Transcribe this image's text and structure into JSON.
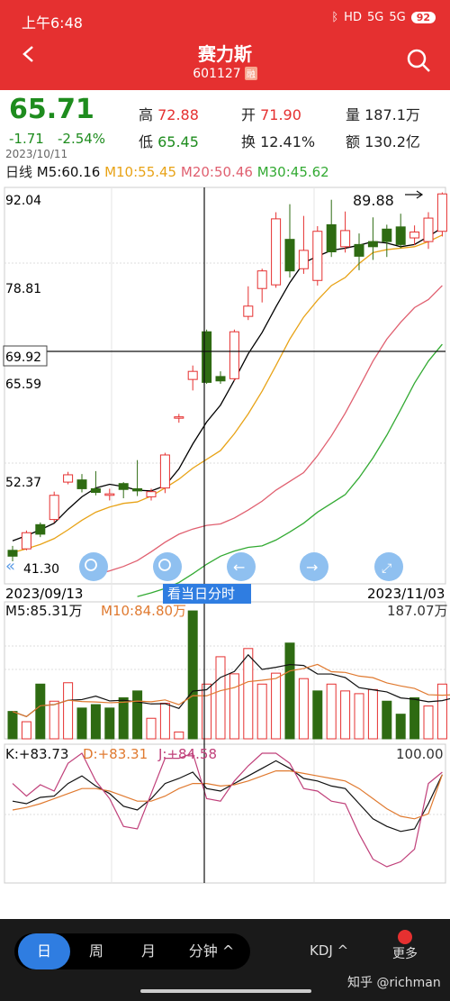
{
  "status": {
    "time": "上午6:48",
    "battery": "92",
    "hd": "HD",
    "net1": "5G",
    "net2": "5G"
  },
  "header": {
    "title": "赛力斯",
    "code": "601127",
    "margin_badge": "融"
  },
  "quote": {
    "price": "65.71",
    "change": "-1.71",
    "change_pct": "-2.54%",
    "high_label": "高",
    "high": "72.88",
    "low_label": "低",
    "low": "65.45",
    "open_label": "开",
    "open": "71.90",
    "turnover_label": "换",
    "turnover": "12.41%",
    "volume_label": "量",
    "volume": "187.1万",
    "amount_label": "额",
    "amount": "130.2亿"
  },
  "selected_date": "2023/10/11",
  "ma_row": {
    "period": "日线",
    "m5": "M5:60.16",
    "m10": "M10:55.45",
    "m20": "M20:50.46",
    "m30": "M30:45.62"
  },
  "chart_labels": {
    "y_top": "92.04",
    "y_2": "78.81",
    "y_cross": "69.92",
    "y_3": "65.59",
    "y_4": "52.37",
    "y_low": "41.30",
    "max_marker": "89.88",
    "date_start": "2023/09/13",
    "date_end": "2023/11/03",
    "intraday_button": "看当日分时"
  },
  "volume_panel": {
    "m5": "M5:85.31万",
    "m10": "M10:84.80万",
    "max": "187.07万"
  },
  "kdj_panel": {
    "k": "K:+83.73",
    "d": "D:+83.31",
    "j": "J:+84.58",
    "max": "100.00"
  },
  "bottom_nav": {
    "tabs": [
      "日",
      "周",
      "月",
      "分钟 ^"
    ],
    "indicator": "KDJ ^",
    "more": "更多"
  },
  "watermark": "知乎 @richman",
  "colors": {
    "up": "#e53030",
    "down": "#2e6b12",
    "m5": "#000000",
    "m10": "#e8a317",
    "m20": "#e06070",
    "m30": "#33aa33",
    "accent": "#2f7de1"
  },
  "chart_data": {
    "type": "candlestick",
    "x_range": [
      "2023/09/13",
      "2023/11/03"
    ],
    "ylim": [
      41.3,
      92.04
    ],
    "candles": [
      {
        "o": 42.8,
        "h": 43.4,
        "l": 41.3,
        "c": 42.0
      },
      {
        "o": 43.0,
        "h": 45.5,
        "l": 42.8,
        "c": 45.2
      },
      {
        "o": 46.3,
        "h": 46.6,
        "l": 44.6,
        "c": 45.0
      },
      {
        "o": 47.0,
        "h": 50.8,
        "l": 46.6,
        "c": 50.3
      },
      {
        "o": 52.1,
        "h": 53.5,
        "l": 51.8,
        "c": 53.1
      },
      {
        "o": 52.4,
        "h": 53.2,
        "l": 50.7,
        "c": 51.2
      },
      {
        "o": 51.2,
        "h": 53.6,
        "l": 50.3,
        "c": 50.7
      },
      {
        "o": 50.3,
        "h": 51.2,
        "l": 49.6,
        "c": 50.5
      },
      {
        "o": 51.9,
        "h": 52.1,
        "l": 49.9,
        "c": 51.1
      },
      {
        "o": 51.2,
        "h": 55.1,
        "l": 50.2,
        "c": 50.9
      },
      {
        "o": 50.1,
        "h": 51.2,
        "l": 49.6,
        "c": 50.8
      },
      {
        "o": 51.3,
        "h": 56.1,
        "l": 50.6,
        "c": 55.8
      },
      {
        "o": 61.0,
        "h": 61.4,
        "l": 60.2,
        "c": 61.0
      },
      {
        "o": 66.1,
        "h": 68.0,
        "l": 64.6,
        "c": 67.2
      },
      {
        "o": 72.6,
        "h": 72.9,
        "l": 65.5,
        "c": 65.7
      },
      {
        "o": 66.5,
        "h": 67.2,
        "l": 65.5,
        "c": 65.9
      },
      {
        "o": 66.2,
        "h": 72.9,
        "l": 65.9,
        "c": 72.6
      },
      {
        "o": 74.7,
        "h": 78.8,
        "l": 74.2,
        "c": 76.1
      },
      {
        "o": 78.5,
        "h": 81.2,
        "l": 76.6,
        "c": 80.9
      },
      {
        "o": 79.0,
        "h": 88.9,
        "l": 78.6,
        "c": 88.0
      },
      {
        "o": 85.2,
        "h": 90.0,
        "l": 80.0,
        "c": 80.9
      },
      {
        "o": 81.2,
        "h": 88.4,
        "l": 80.5,
        "c": 83.7
      },
      {
        "o": 79.6,
        "h": 87.0,
        "l": 78.9,
        "c": 86.3
      },
      {
        "o": 87.2,
        "h": 90.6,
        "l": 82.8,
        "c": 83.5
      },
      {
        "o": 84.2,
        "h": 89.0,
        "l": 83.4,
        "c": 86.4
      },
      {
        "o": 84.5,
        "h": 86.0,
        "l": 81.0,
        "c": 82.9
      },
      {
        "o": 84.9,
        "h": 88.2,
        "l": 82.4,
        "c": 84.2
      },
      {
        "o": 86.6,
        "h": 87.2,
        "l": 82.8,
        "c": 84.9
      },
      {
        "o": 86.9,
        "h": 88.7,
        "l": 84.0,
        "c": 84.5
      },
      {
        "o": 85.4,
        "h": 87.1,
        "l": 84.4,
        "c": 86.2
      },
      {
        "o": 84.9,
        "h": 88.9,
        "l": 83.9,
        "c": 88.1
      },
      {
        "o": 86.3,
        "h": 91.6,
        "l": 85.6,
        "c": 91.4
      }
    ],
    "ma5": [
      44.1,
      44.8,
      45.6,
      46.5,
      48.4,
      50.1,
      51.3,
      51.8,
      51.5,
      51.0,
      50.9,
      51.6,
      53.9,
      57.3,
      60.3,
      62.6,
      66.0,
      69.6,
      72.5,
      76.0,
      79.3,
      82.0,
      82.9,
      83.7,
      84.0,
      84.4,
      84.9,
      84.7,
      84.2,
      84.5,
      85.6,
      86.8
    ],
    "ma10": [
      42.5,
      43.0,
      43.6,
      44.4,
      45.6,
      46.9,
      48.0,
      48.7,
      49.2,
      49.4,
      50.2,
      51.3,
      52.5,
      54.0,
      55.2,
      56.4,
      58.7,
      61.4,
      64.5,
      68.0,
      71.6,
      74.6,
      76.9,
      78.9,
      80.0,
      81.9,
      83.4,
      83.8,
      84.0,
      84.2,
      84.9,
      85.8
    ],
    "ma20": [
      null,
      null,
      null,
      null,
      null,
      null,
      null,
      null,
      null,
      null,
      null,
      null,
      null,
      null,
      null,
      null,
      null,
      null,
      null,
      null,
      null,
      null,
      null,
      null,
      null,
      null,
      null,
      null,
      null,
      null,
      null,
      null
    ],
    "volume": [
      {
        "v": 40,
        "up": false
      },
      {
        "v": 25,
        "up": true
      },
      {
        "v": 80,
        "up": false
      },
      {
        "v": 55,
        "up": true
      },
      {
        "v": 82,
        "up": true
      },
      {
        "v": 45,
        "up": false
      },
      {
        "v": 50,
        "up": false
      },
      {
        "v": 45,
        "up": false
      },
      {
        "v": 60,
        "up": false
      },
      {
        "v": 70,
        "up": false
      },
      {
        "v": 30,
        "up": true
      },
      {
        "v": 52,
        "up": true
      },
      {
        "v": 10,
        "up": true
      },
      {
        "v": 187,
        "up": false
      },
      {
        "v": 80,
        "up": true
      },
      {
        "v": 120,
        "up": true
      },
      {
        "v": 95,
        "up": true
      },
      {
        "v": 132,
        "up": true
      },
      {
        "v": 80,
        "up": true
      },
      {
        "v": 96,
        "up": true
      },
      {
        "v": 140,
        "up": false
      },
      {
        "v": 88,
        "up": true
      },
      {
        "v": 70,
        "up": false
      },
      {
        "v": 80,
        "up": true
      },
      {
        "v": 70,
        "up": true
      },
      {
        "v": 66,
        "up": true
      },
      {
        "v": 72,
        "up": true
      },
      {
        "v": 55,
        "up": false
      },
      {
        "v": 36,
        "up": false
      },
      {
        "v": 60,
        "up": false
      },
      {
        "v": 48,
        "up": true
      },
      {
        "v": 80,
        "up": true
      },
      {
        "v": 80,
        "up": true
      }
    ],
    "kdj": {
      "k": [
        62,
        60,
        65,
        66,
        76,
        82,
        74,
        68,
        58,
        55,
        64,
        76,
        80,
        85,
        72,
        70,
        76,
        82,
        88,
        94,
        88,
        80,
        78,
        74,
        72,
        60,
        48,
        42,
        38,
        40,
        60,
        83
      ],
      "d": [
        55,
        57,
        60,
        64,
        68,
        72,
        72,
        70,
        66,
        62,
        62,
        66,
        72,
        76,
        76,
        74,
        75,
        78,
        82,
        86,
        86,
        84,
        82,
        80,
        78,
        72,
        64,
        56,
        50,
        48,
        52,
        83
      ],
      "j": [
        76,
        66,
        75,
        70,
        92,
        100,
        78,
        64,
        42,
        40,
        68,
        96,
        96,
        100,
        64,
        62,
        78,
        90,
        100,
        100,
        92,
        72,
        70,
        62,
        60,
        36,
        16,
        10,
        14,
        24,
        76,
        85
      ]
    }
  }
}
